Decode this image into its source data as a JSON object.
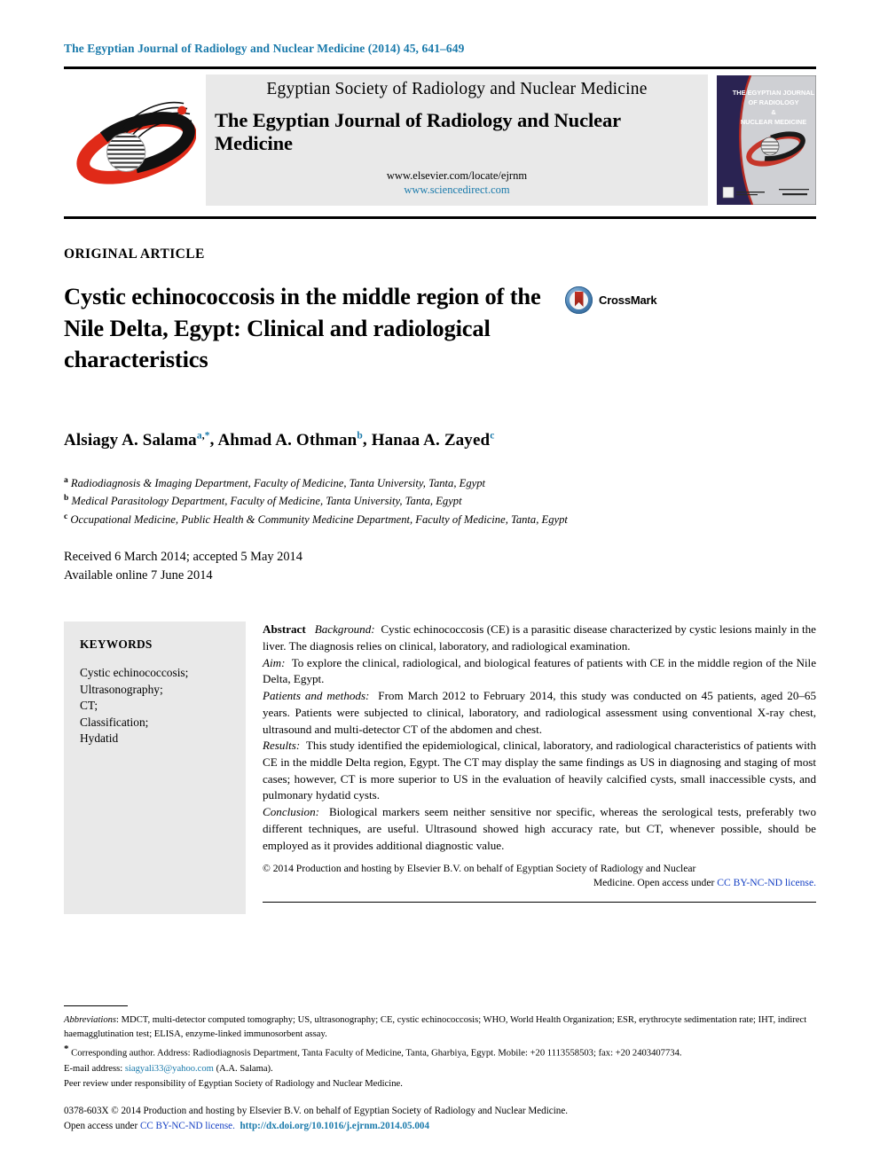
{
  "running_head": "The Egyptian Journal of Radiology and Nuclear Medicine (2014) 45, 641–649",
  "masthead": {
    "society": "Egyptian Society of Radiology and Nuclear Medicine",
    "journal": "The Egyptian Journal of Radiology and Nuclear Medicine",
    "url_elsevier": "www.elsevier.com/locate/ejrnm",
    "url_sciencedirect": "www.sciencedirect.com",
    "cover_title_lines": [
      "THE EGYPTIAN JOURNAL",
      "OF RADIOLOGY",
      "&",
      "NUCLEAR MEDICINE"
    ],
    "logo_name": "egyptian-society-radiology-logo",
    "cover_name": "journal-cover-thumbnail"
  },
  "article": {
    "type": "ORIGINAL ARTICLE",
    "title": "Cystic echinococcosis in the middle region of the Nile Delta, Egypt: Clinical and radiological characteristics",
    "crossmark_label": "CrossMark"
  },
  "authors": [
    {
      "name": "Alsiagy A. Salama",
      "sup": "a",
      "star": true,
      "separator": ", "
    },
    {
      "name": "Ahmad A. Othman",
      "sup": "b",
      "star": false,
      "separator": ", "
    },
    {
      "name": "Hanaa A. Zayed",
      "sup": "c",
      "star": false,
      "separator": ""
    }
  ],
  "affiliations": [
    {
      "marker": "a",
      "text": "Radiodiagnosis & Imaging Department, Faculty of Medicine, Tanta University, Tanta, Egypt"
    },
    {
      "marker": "b",
      "text": "Medical Parasitology Department, Faculty of Medicine, Tanta University, Tanta, Egypt"
    },
    {
      "marker": "c",
      "text": "Occupational Medicine, Public Health & Community Medicine Department, Faculty of Medicine, Tanta, Egypt"
    }
  ],
  "dates": {
    "line1": "Received 6 March 2014; accepted 5 May 2014",
    "line2": "Available online 7 June 2014"
  },
  "keywords": {
    "heading": "KEYWORDS",
    "items": [
      "Cystic echinococcosis;",
      "Ultrasonography;",
      "CT;",
      "Classification;",
      "Hydatid"
    ]
  },
  "abstract": {
    "heading": "Abstract",
    "sections": [
      {
        "label": "Background:",
        "text": "Cystic echinococcosis (CE) is a parasitic disease characterized by cystic lesions mainly in the liver. The diagnosis relies on clinical, laboratory, and radiological examination."
      },
      {
        "label": "Aim:",
        "text": "To explore the clinical, radiological, and biological features of patients with CE in the middle region of the Nile Delta, Egypt."
      },
      {
        "label": "Patients and methods:",
        "text": "From March 2012 to February 2014, this study was conducted on 45 patients, aged 20–65 years. Patients were subjected to clinical, laboratory, and radiological assessment using conventional X-ray chest, ultrasound and multi-detector CT of the abdomen and chest."
      },
      {
        "label": "Results:",
        "text": "This study identified the epidemiological, clinical, laboratory, and radiological characteristics of patients with CE in the middle Delta region, Egypt. The CT may display the same findings as US in diagnosing and staging of most cases; however, CT is more superior to US in the evaluation of heavily calcified cysts, small inaccessible cysts, and pulmonary hydatid cysts."
      },
      {
        "label": "Conclusion:",
        "text": "Biological markers seem neither sensitive nor specific, whereas the serological tests, preferably two different techniques, are useful. Ultrasound showed high accuracy rate, but CT, whenever possible, should be employed as it provides additional diagnostic value."
      }
    ],
    "copyright_lead": "© 2014 Production and hosting by Elsevier B.V. on behalf of Egyptian Society of Radiology and Nuclear",
    "copyright_tail": "Medicine. Open access under ",
    "copyright_link": "CC BY-NC-ND license."
  },
  "footnotes": {
    "abbreviations_label": "Abbreviations",
    "abbreviations_text": ": MDCT, multi-detector computed tomography; US, ultrasonography; CE, cystic echinococcosis; WHO, World Health Organization; ESR, erythrocyte sedimentation rate; IHT, indirect haemagglutination test; ELISA, enzyme-linked immunosorbent assay.",
    "corresponding": "Corresponding author. Address: Radiodiagnosis Department, Tanta Faculty of Medicine, Tanta, Gharbiya, Egypt. Mobile: +20 1113558503; fax: +20 2403407734.",
    "email_label": "E-mail address: ",
    "email": "siagyali33@yahoo.com",
    "email_suffix": " (A.A. Salama).",
    "peer_review": "Peer review under responsibility of Egyptian Society of Radiology and Nuclear Medicine."
  },
  "bottom": {
    "issn_line": "0378-603X © 2014 Production and hosting by Elsevier B.V. on behalf of Egyptian Society of Radiology and Nuclear Medicine.",
    "open_access_prefix": "Open access under ",
    "license_link": "CC BY-NC-ND license.",
    "doi": "http://dx.doi.org/10.1016/j.ejrnm.2014.05.004"
  }
}
